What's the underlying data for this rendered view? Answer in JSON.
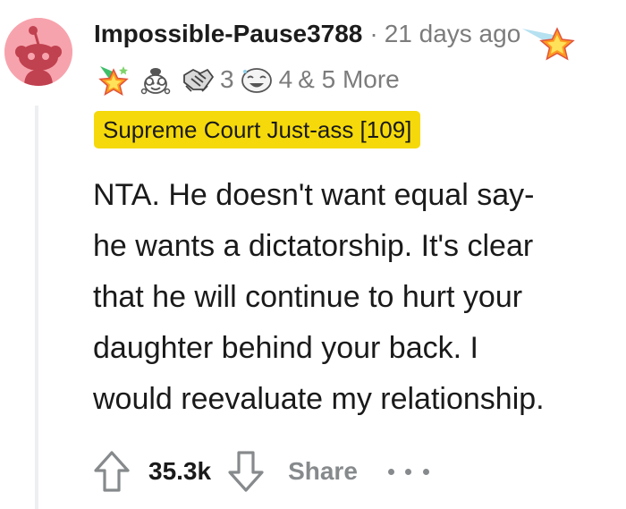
{
  "comment": {
    "author": "Impossible-Pause3788",
    "separator": "·",
    "timestamp": "21 days ago",
    "awards": [
      {
        "icon": "star-party-hat-award-icon"
      },
      {
        "icon": "wholesome-face-award-icon"
      },
      {
        "icon": "handshake-award-icon",
        "count": "3"
      },
      {
        "icon": "laughing-face-award-icon",
        "count": "4"
      }
    ],
    "more_awards": "& 5 More",
    "flair": "Supreme Court Just-ass [109]",
    "flair_color": "#f5d90a",
    "body_lines": [
      "NTA. He doesn't want equal say-",
      "he wants a dictatorship. It's clear",
      "that he will continue to hurt your",
      "daughter behind your back. I",
      "would reevaluate my relationship."
    ]
  },
  "actions": {
    "score": "35.3k",
    "share_label": "Share"
  },
  "colors": {
    "avatar_bg": "#f7a3ad",
    "meta_text": "#7c7c7c",
    "action_gray": "#878a8c"
  }
}
